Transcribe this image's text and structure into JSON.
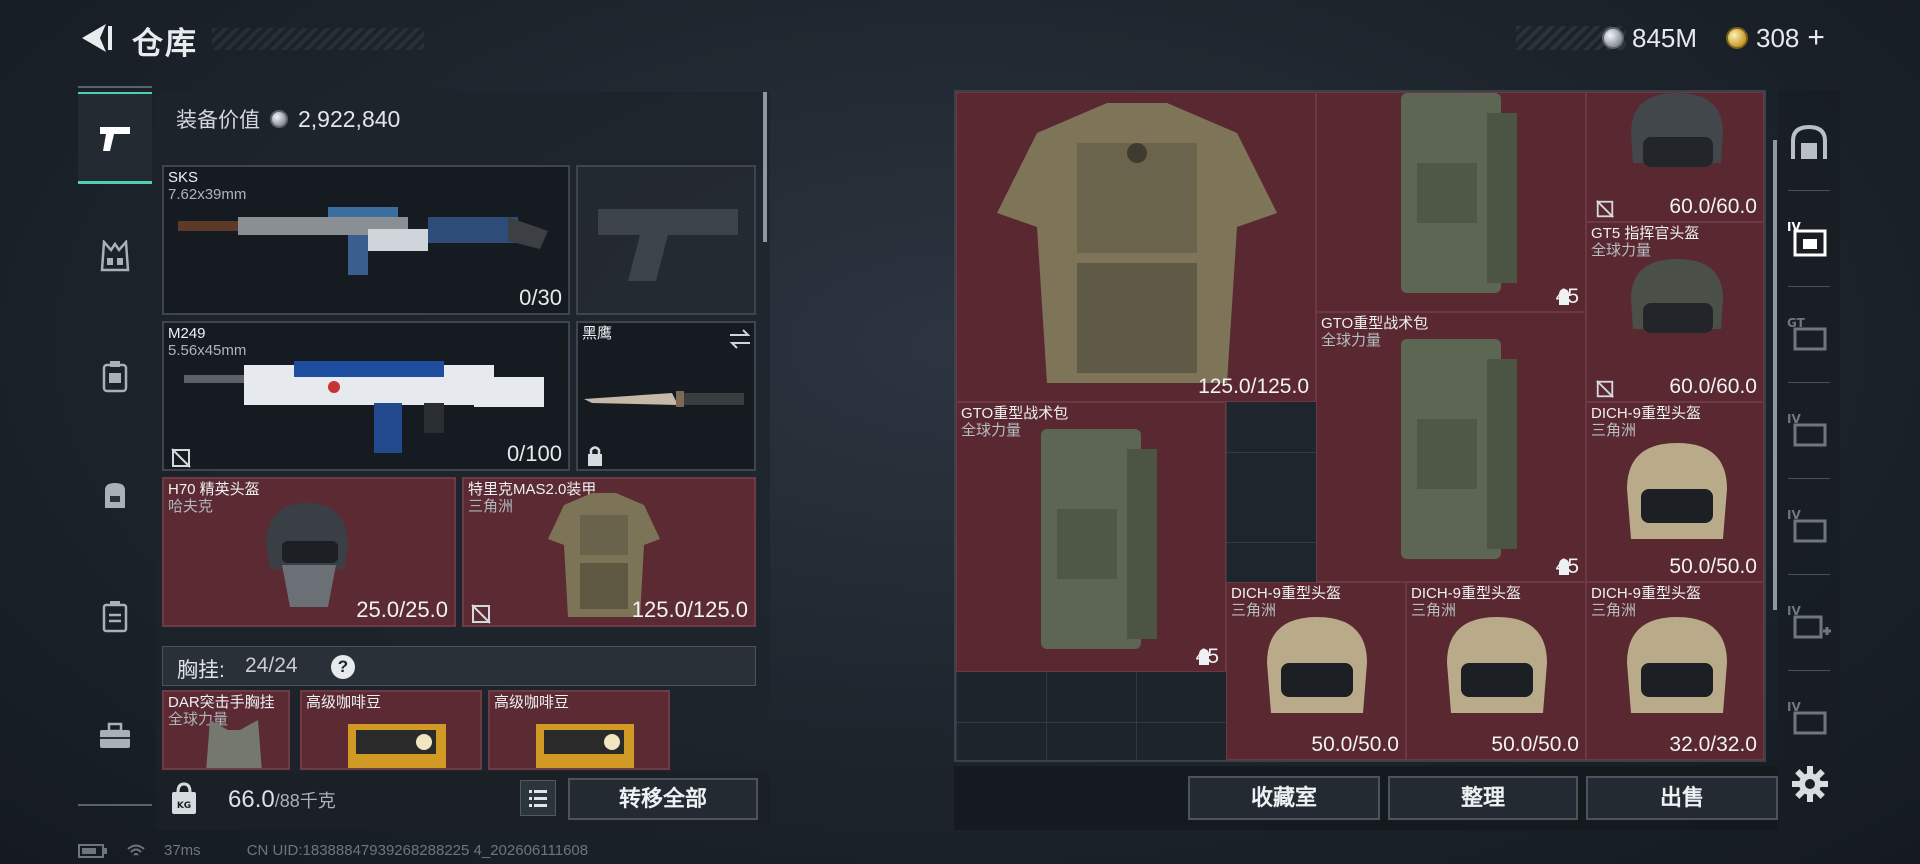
{
  "header": {
    "title": "仓库",
    "currency_silver": "845M",
    "currency_gold": "308",
    "currency_gold_plus": "+"
  },
  "left_nav": {
    "items": [
      "weapon-icon",
      "vest-icon",
      "armor-icon",
      "backpack-icon",
      "case-icon",
      "toolbox-icon"
    ]
  },
  "equipment": {
    "value_label": "装备价值",
    "value": "2,922,840",
    "slots": [
      {
        "name": "SKS",
        "sub": "7.62x39mm",
        "count": "0/30"
      },
      {
        "name": "M249",
        "sub": "5.56x45mm",
        "count": "0/100"
      },
      {
        "name": "黑鹰",
        "sub": ""
      },
      {
        "name": "H70 精英头盔",
        "sub": "哈夫克",
        "durability": "25.0/25.0"
      },
      {
        "name": "特里克MAS2.0装甲",
        "sub": "三角洲",
        "durability": "125.0/125.0"
      }
    ],
    "chest_label": "胸挂:",
    "chest_count": "24/24",
    "chest_help": "?",
    "chest_items": [
      {
        "name": "DAR突击手胸挂",
        "sub": "全球力量"
      },
      {
        "name": "高级咖啡豆",
        "sub": ""
      },
      {
        "name": "高级咖啡豆",
        "sub": ""
      }
    ]
  },
  "weight": {
    "current": "66.0",
    "max": "/88千克"
  },
  "actions": {
    "transfer_all": "转移全部",
    "collection": "收藏室",
    "sort": "整理",
    "sell": "出售"
  },
  "status": {
    "ping": "37ms",
    "uid": "CN UID:18388847939268288225 4_202606111608"
  },
  "grid_items": [
    {
      "name": "",
      "sub": "",
      "value": "125.0/125.0"
    },
    {
      "name": "",
      "sub": "",
      "value": "45"
    },
    {
      "name": "",
      "sub": "",
      "value": "60.0/60.0"
    },
    {
      "name": "GT5 指挥官头盔",
      "sub": "全球力量",
      "value": "60.0/60.0"
    },
    {
      "name": "GTO重型战术包",
      "sub": "全球力量",
      "value": "45"
    },
    {
      "name": "GTO重型战术包",
      "sub": "全球力量",
      "value": "45"
    },
    {
      "name": "DICH-9重型头盔",
      "sub": "三角洲",
      "value": "50.0/50.0"
    },
    {
      "name": "DICH-9重型头盔",
      "sub": "三角洲",
      "value": "50.0/50.0"
    },
    {
      "name": "DICH-9重型头盔",
      "sub": "三角洲",
      "value": "50.0/50.0"
    },
    {
      "name": "DICH-9重型头盔",
      "sub": "三角洲",
      "value": "32.0/32.0"
    }
  ],
  "colors": {
    "accent": "#4fd0b2",
    "item_bg": "#5a2830",
    "panel_bg": "#1e242b"
  }
}
